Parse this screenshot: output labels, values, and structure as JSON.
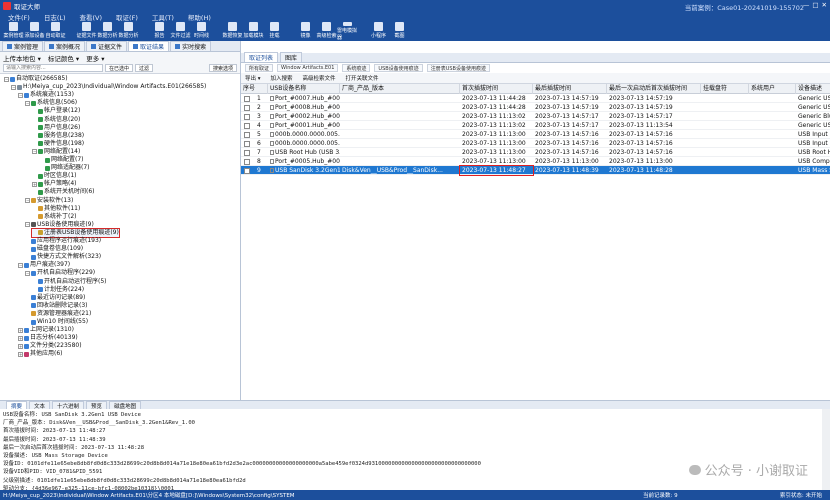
{
  "app": {
    "title": "取证大师",
    "case_label": "当前案例：",
    "case_name": "Case01-20241019-155702",
    "window_buttons": [
      "—",
      "□",
      "✕"
    ]
  },
  "menu": [
    "文件(F)",
    "日志(L)",
    "查看(V)",
    "取证(F)",
    "工具(T)",
    "帮助(H)"
  ],
  "ribbon": [
    "案例管理",
    "添加设备",
    "自动取证",
    "证据文件",
    "数据分析",
    "数据分析",
    "报告",
    "文件过滤",
    "时间线",
    "数据恢复",
    "加载模块",
    "挂载",
    "镜像",
    "高级检索",
    "雷电模拟器",
    "小程序",
    "截图"
  ],
  "left_tabs": [
    {
      "label": "案例管理",
      "active": false
    },
    {
      "label": "案例概况",
      "active": false
    },
    {
      "label": "证据文件",
      "active": false
    },
    {
      "label": "取证结果",
      "active": true
    },
    {
      "label": "实时搜索",
      "active": false
    }
  ],
  "left_toolbar": [
    "上传本地包 ▾",
    "标记颜色 ▾",
    "更多 ▾"
  ],
  "left_search": {
    "placeholder": "请输入搜索内容...",
    "btn1": "在已选中",
    "btn2": "过滤",
    "right": "搜索选项"
  },
  "tree": [
    {
      "label": "自动取证(266585)",
      "indent": 0,
      "exp": "−",
      "color": "#3a7fd5"
    },
    {
      "label": "H:\\Meiya_cup_2023\\Individual\\Window Artifacts.E01(266585)",
      "indent": 1,
      "exp": "−",
      "color": "#7a8a9a"
    },
    {
      "label": "系统痕迹(1153)",
      "indent": 2,
      "exp": "−",
      "color": "#3a7fd5"
    },
    {
      "label": "系统信息(506)",
      "indent": 3,
      "exp": "−",
      "color": "#2f9a4a"
    },
    {
      "label": "帐户登录(12)",
      "indent": 4,
      "exp": "",
      "color": "#2f9a4a"
    },
    {
      "label": "系统信息(20)",
      "indent": 4,
      "exp": "",
      "color": "#2f9a4a"
    },
    {
      "label": "用户信息(26)",
      "indent": 4,
      "exp": "",
      "color": "#2f9a4a"
    },
    {
      "label": "服务信息(238)",
      "indent": 4,
      "exp": "",
      "color": "#2f9a4a"
    },
    {
      "label": "硬件信息(198)",
      "indent": 4,
      "exp": "",
      "color": "#2f9a4a"
    },
    {
      "label": "网络配置(14)",
      "indent": 4,
      "exp": "−",
      "color": "#2f9a4a"
    },
    {
      "label": "网络配置(7)",
      "indent": 5,
      "exp": "",
      "color": "#2f9a4a"
    },
    {
      "label": "网络适配器(7)",
      "indent": 5,
      "exp": "",
      "color": "#2f9a4a"
    },
    {
      "label": "时区信息(1)",
      "indent": 4,
      "exp": "",
      "color": "#2f9a4a"
    },
    {
      "label": "帐户策略(4)",
      "indent": 4,
      "exp": "+",
      "color": "#2f9a4a"
    },
    {
      "label": "系统开关机时间(6)",
      "indent": 4,
      "exp": "",
      "color": "#2f9a4a"
    },
    {
      "label": "安装软件(13)",
      "indent": 3,
      "exp": "−",
      "color": "#d59a2f"
    },
    {
      "label": "其他软件(11)",
      "indent": 4,
      "exp": "",
      "color": "#d59a2f"
    },
    {
      "label": "系统补丁(2)",
      "indent": 4,
      "exp": "",
      "color": "#d59a2f"
    },
    {
      "label": "USB设备使用痕迹(9)",
      "indent": 3,
      "exp": "−",
      "color": "#555555"
    },
    {
      "label": "注册表USB设备使用痕迹(9)",
      "indent": 4,
      "exp": "",
      "color": "#c8a02f",
      "selected": true
    },
    {
      "label": "应用程序运行痕迹(193)",
      "indent": 3,
      "exp": "",
      "color": "#3a7fd5"
    },
    {
      "label": "磁盘卷信息(109)",
      "indent": 3,
      "exp": "",
      "color": "#3a7fd5"
    },
    {
      "label": "快捷方式文件解析(323)",
      "indent": 3,
      "exp": "",
      "color": "#3a7fd5"
    },
    {
      "label": "用户痕迹(397)",
      "indent": 2,
      "exp": "−",
      "color": "#3a7fd5"
    },
    {
      "label": "开机自启动程序(229)",
      "indent": 3,
      "exp": "−",
      "color": "#3a7fd5"
    },
    {
      "label": "开机自启动运行程序(5)",
      "indent": 4,
      "exp": "",
      "color": "#3a7fd5"
    },
    {
      "label": "计划任务(224)",
      "indent": 4,
      "exp": "",
      "color": "#3a7fd5"
    },
    {
      "label": "最近访问记录(89)",
      "indent": 3,
      "exp": "",
      "color": "#3a7fd5"
    },
    {
      "label": "回收站删除记录(3)",
      "indent": 3,
      "exp": "",
      "color": "#3a7fd5"
    },
    {
      "label": "资源管理器痕迹(21)",
      "indent": 3,
      "exp": "",
      "color": "#d59a2f"
    },
    {
      "label": "Win10 时间线(55)",
      "indent": 3,
      "exp": "",
      "color": "#3a7fd5"
    },
    {
      "label": "上网记录(1310)",
      "indent": 2,
      "exp": "+",
      "color": "#3a7fd5"
    },
    {
      "label": "日志分析(40139)",
      "indent": 2,
      "exp": "+",
      "color": "#3a7fd5"
    },
    {
      "label": "文件分类(223580)",
      "indent": 2,
      "exp": "+",
      "color": "#3a7fd5"
    },
    {
      "label": "其他应用(6)",
      "indent": 2,
      "exp": "+",
      "color": "#c33a6a"
    }
  ],
  "right_tabs": [
    {
      "label": "取证列表",
      "active": true
    },
    {
      "label": "图库",
      "active": false
    }
  ],
  "breadcrumb": [
    "所有取证",
    "Window Artifacts.E01",
    "系统痕迹",
    "USB设备使用痕迹",
    "注册表USB设备使用痕迹"
  ],
  "right_toolbar": [
    "导出 ▾",
    "加入搜索",
    "高级检索文件",
    "打开关联文件"
  ],
  "table": {
    "columns": [
      "序号",
      "USB设备名称",
      "厂商_产品_版本",
      "首次插拔时间",
      "最后插拔时间",
      "最后一次启动后首次插拔时间",
      "挂载盘符",
      "系统用户",
      "设备描述"
    ],
    "rows": [
      [
        "1",
        "Port_#0007.Hub_#0003",
        "",
        "2023-07-13 11:44:28",
        "2023-07-13 14:57:19",
        "2023-07-13 14:57:19",
        "",
        "",
        "Generic USB"
      ],
      [
        "2",
        "Port_#0008.Hub_#0003",
        "",
        "2023-07-13 11:44:28",
        "2023-07-13 14:57:19",
        "2023-07-13 14:57:19",
        "",
        "",
        "Generic USB"
      ],
      [
        "3",
        "Port_#0002.Hub_#0001",
        "",
        "2023-07-13 11:13:02",
        "2023-07-13 14:57:17",
        "2023-07-13 14:57:17",
        "",
        "",
        "Generic Blue"
      ],
      [
        "4",
        "Port_#0001.Hub_#0001",
        "",
        "2023-07-13 11:13:02",
        "2023-07-13 14:57:17",
        "2023-07-13 11:13:54",
        "",
        "",
        "Generic USB"
      ],
      [
        "5",
        "000b.0000.0000.005.000.000...",
        "",
        "2023-07-13 11:13:00",
        "2023-07-13 14:57:16",
        "2023-07-13 14:57:16",
        "",
        "",
        "USB Input D"
      ],
      [
        "6",
        "000b.0000.0000.005.000.000...",
        "",
        "2023-07-13 11:13:00",
        "2023-07-13 14:57:16",
        "2023-07-13 14:57:16",
        "",
        "",
        "USB Input D"
      ],
      [
        "7",
        "USB Root Hub (USB 3.0)",
        "",
        "2023-07-13 11:13:00",
        "2023-07-13 14:57:16",
        "2023-07-13 14:57:16",
        "",
        "",
        "USB Root H"
      ],
      [
        "8",
        "Port_#0005.Hub_#0003",
        "",
        "2023-07-13 11:13:00",
        "2023-07-13 11:13:00",
        "2023-07-13 11:13:00",
        "",
        "",
        "USB Compo"
      ],
      [
        "9",
        "USB  SanDisk 3.2Gen1 USB D...",
        "Disk&Ven__USB&Prod__SanDisk...",
        "2023-07-13 11:48:27",
        "2023-07-13 11:48:39",
        "2023-07-13 11:48:28",
        "",
        "",
        "USB Mass S"
      ]
    ],
    "selected_row": 8
  },
  "bottom_tabs": [
    {
      "label": "摘要",
      "active": true
    },
    {
      "label": "文本",
      "active": false
    },
    {
      "label": "十六进制",
      "active": false
    },
    {
      "label": "预览",
      "active": false
    },
    {
      "label": "磁盘地图",
      "active": false
    }
  ],
  "details": [
    "USB设备名称: USB  SanDisk 3.2Gen1 USB Device",
    "厂商_产品_版本: Disk&Ven__USB&Prod__SanDisk_3.2Gen1&Rev_1.00",
    "首次插拔时间: 2023-07-13 11:48:27",
    "最后插拔时间: 2023-07-13 11:48:39",
    "最后一次启动后首次插拔时间: 2023-07-13 11:48:28",
    "设备描述: USB Mass Storage Device",
    "设备ID: 0101dfe11e65ebe8db8fd0d8c333d28699c20d8b8d014a71e18e80ea61bfd2d3e2ac00000000000000000000a5abe459ef0324d9310000000000000000000000000000000",
    "设备VID和PID: VID_0781&PID_5591",
    "父级别描述: 0101dfe11e65ebe8db8fd0d8c333d28699c20d8b8d014a71e18e80ea61bfd2d",
    "驱动分支: {4d36e967-e325-11ce-bfc1-08002be10318}\\0001"
  ],
  "watermark": "公众号 · 小谢取证",
  "statusbar": {
    "path": "H:\\Meiya_cup_2023\\Individual\\Window Artifacts.E01\\分区4 本地磁盘[D:]\\Windows\\System32\\config\\SYSTEM",
    "count": "当前记录数: 9",
    "status": "索引状态: 未开始"
  }
}
